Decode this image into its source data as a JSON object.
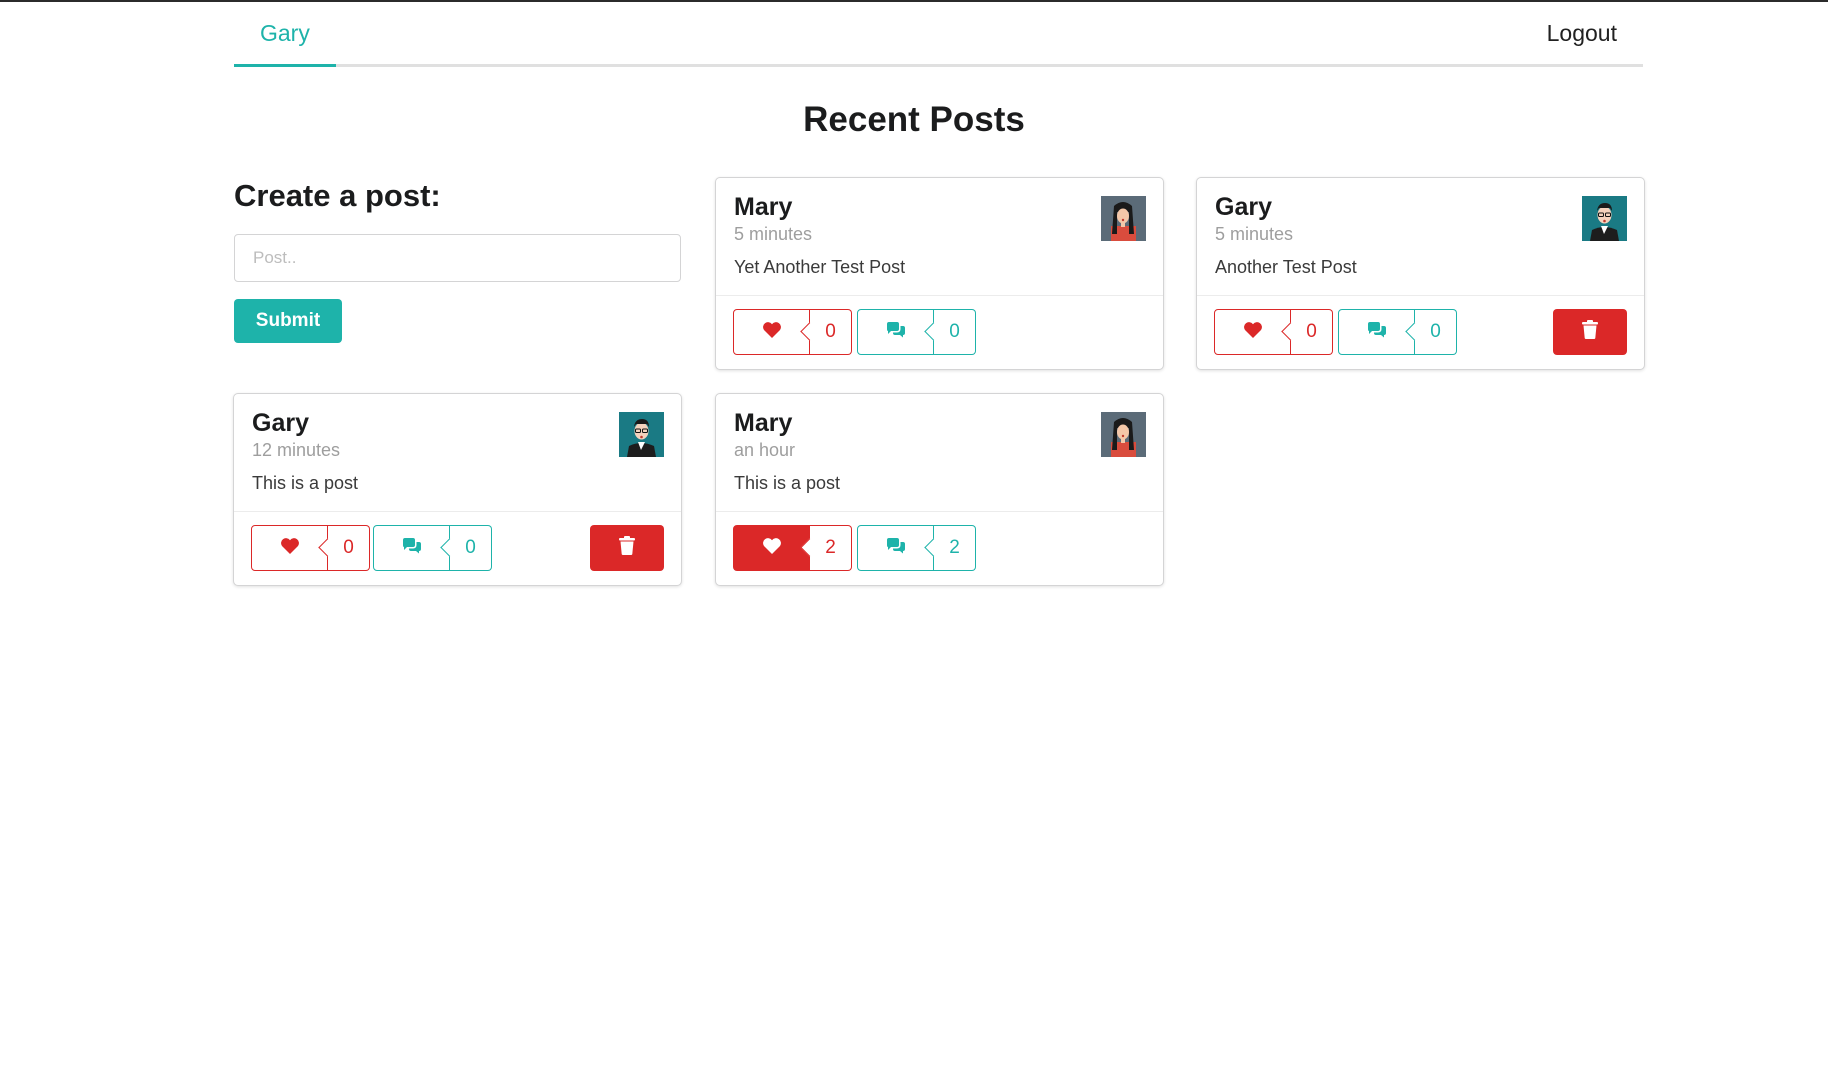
{
  "nav": {
    "user": "Gary",
    "logout": "Logout"
  },
  "page_title": "Recent Posts",
  "create": {
    "heading": "Create a post:",
    "placeholder": "Post..",
    "submit": "Submit"
  },
  "colors": {
    "accent": "#1eb3aa",
    "danger": "#db2828"
  },
  "posts": [
    {
      "author": "Mary",
      "time": "5 minutes",
      "text": "Yet Another Test Post",
      "likes": "0",
      "comments": "0",
      "liked": false,
      "deletable": false,
      "avatar": "woman-avatar"
    },
    {
      "author": "Gary",
      "time": "5 minutes",
      "text": "Another Test Post",
      "likes": "0",
      "comments": "0",
      "liked": false,
      "deletable": true,
      "avatar": "man-avatar"
    },
    {
      "author": "Gary",
      "time": "12 minutes",
      "text": "This is a post",
      "likes": "0",
      "comments": "0",
      "liked": false,
      "deletable": true,
      "avatar": "man-avatar"
    },
    {
      "author": "Mary",
      "time": "an hour",
      "text": "This is a post",
      "likes": "2",
      "comments": "2",
      "liked": true,
      "deletable": false,
      "avatar": "woman-avatar"
    }
  ]
}
